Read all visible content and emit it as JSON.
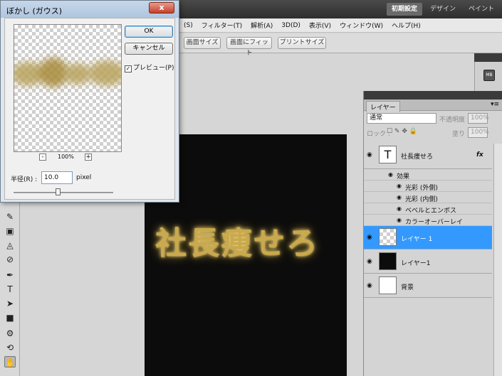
{
  "app": {
    "workspace_buttons": [
      {
        "label": "初期設定",
        "active": true
      },
      {
        "label": "デザイン",
        "active": false
      },
      {
        "label": "ペイント",
        "active": false
      }
    ],
    "menus": [
      "(S)",
      "フィルター(T)",
      "解析(A)",
      "3D(D)",
      "表示(V)",
      "ウィンドウ(W)",
      "ヘルプ(H)"
    ],
    "options": {
      "screen_size_label": "画面サイズ",
      "fit_screen_label": "画面にフィット",
      "print_size_label": "プリントサイズ"
    },
    "panel_icon_label": "MB"
  },
  "canvas": {
    "text": "社長痩せろ",
    "text_color": "#caa94c",
    "background": "#0c0c0c"
  },
  "dialog": {
    "title": "ぼかし (ガウス)",
    "close_symbol": "x",
    "ok_label": "OK",
    "cancel_label": "キャンセル",
    "preview_label": "プレビュー(P)",
    "preview_checked": true,
    "check_mark": "✓",
    "zoom_minus": "-",
    "zoom_plus": "+",
    "zoom_value": "100%",
    "radius_label": "半径(R) :",
    "radius_value": "10.0",
    "radius_unit": "pixel",
    "slider_position": 0.44
  },
  "layers_panel": {
    "tab_label": "レイヤー",
    "blend_mode": "通常",
    "opacity_label": "不透明度 :",
    "opacity_value": "100%",
    "lock_label": "ロック :",
    "fill_label": "塗り :",
    "fill_value": "100%",
    "fx_label": "fx",
    "text_layer": {
      "thumb_symbol": "T",
      "name": "社長痩せろ",
      "effects_label": "効果",
      "effects": [
        "光彩 (外側)",
        "光彩 (内側)",
        "ベベルとエンボス",
        "カラーオーバーレイ"
      ]
    },
    "layers": [
      {
        "name": "レイヤー 1",
        "selected": true,
        "thumb": "transparent"
      },
      {
        "name": "レイヤー1",
        "selected": false,
        "thumb": "black"
      },
      {
        "name": "背景",
        "selected": false,
        "thumb": "white"
      }
    ],
    "selected_color": "#3399ff"
  }
}
